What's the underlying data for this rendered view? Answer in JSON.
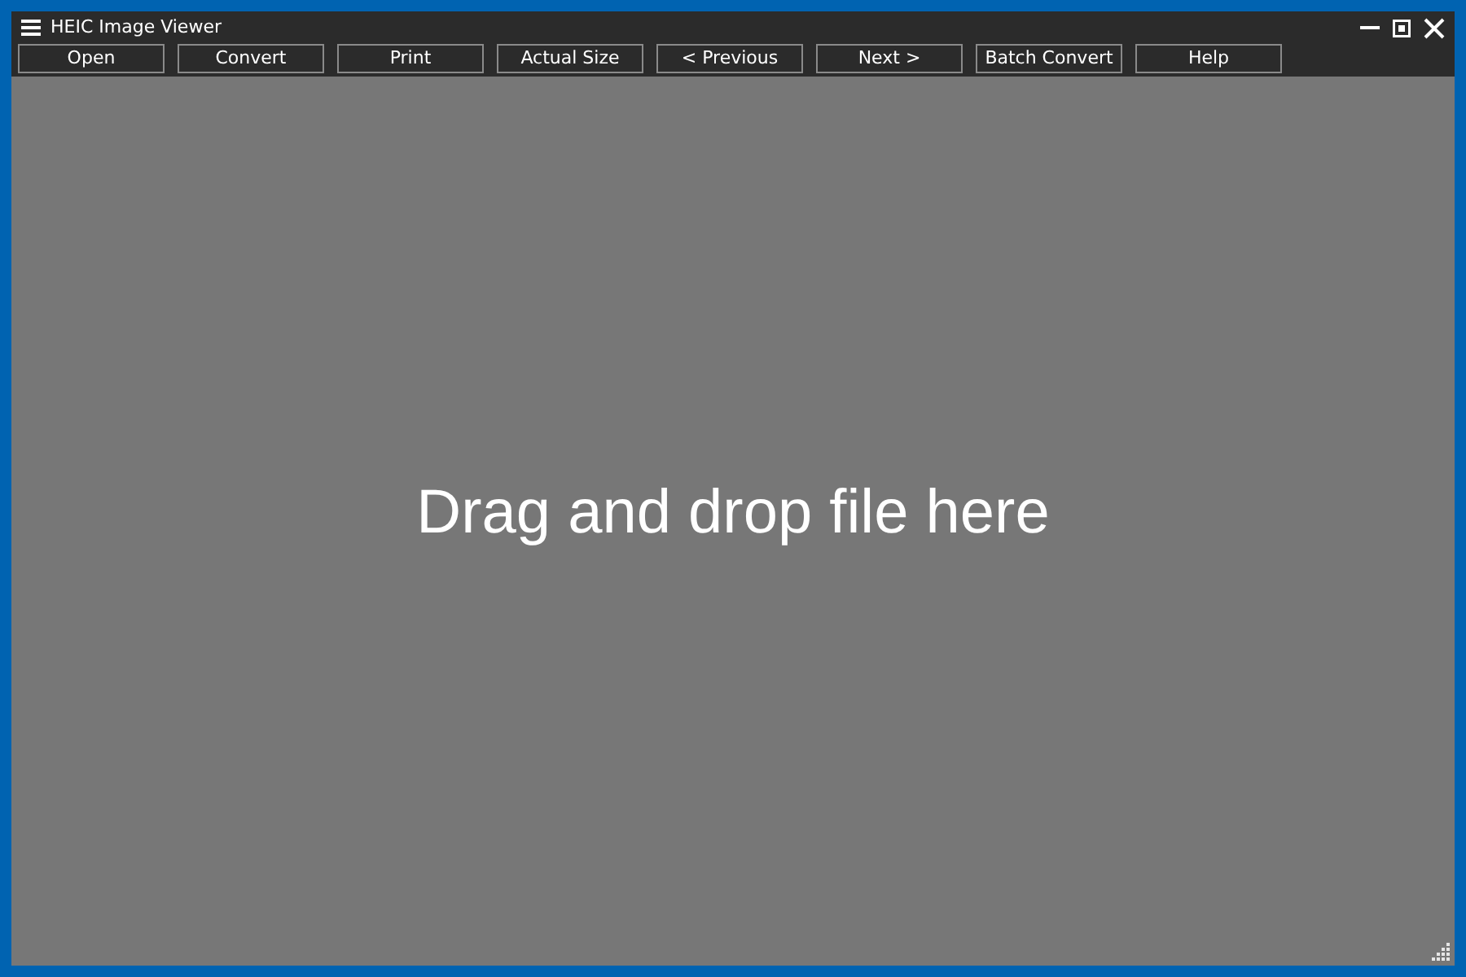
{
  "window": {
    "title": "HEIC Image Viewer"
  },
  "toolbar": {
    "buttons": [
      "Open",
      "Convert",
      "Print",
      "Actual Size",
      "< Previous",
      "Next >",
      "Batch Convert",
      "Help"
    ]
  },
  "viewer": {
    "hint": "Drag and drop file here"
  }
}
